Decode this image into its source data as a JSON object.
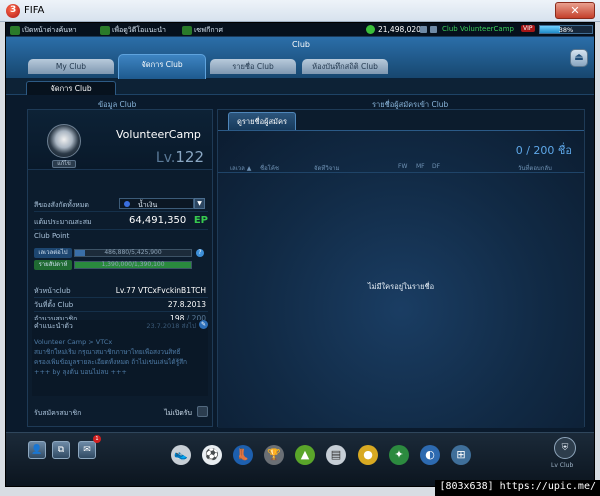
{
  "window": {
    "title": "FIFA",
    "app_icon_letter": "3",
    "close_glyph": "✕"
  },
  "topbar": {
    "nav": [
      "เปิดหน้าต่างค้นหา",
      "เพื่อดูวิดีโอแนะนำ",
      "เซฟกีกาศ"
    ],
    "coins": "21,498,020",
    "ticker": "Club VolunteerCamp",
    "vip": "VIP",
    "exp_percent": 38,
    "exp_label": "38%"
  },
  "header": {
    "title": "Club",
    "tabs": [
      {
        "label": "My Club",
        "active": false
      },
      {
        "label": "จัดการ Club",
        "active": true
      },
      {
        "label": "รายชื่อ Club",
        "active": false
      },
      {
        "label": "ห้องบันทึกสถิติ Club",
        "active": false
      }
    ],
    "home_glyph": "⏏",
    "subtab": "จัดการ Club"
  },
  "sections": {
    "left": "ข้อมูล Club",
    "right": "รายชื่อผู้สมัครเข้า Club"
  },
  "club": {
    "crest_button": "แก้ไข",
    "name": "VolunteerCamp",
    "lv_prefix": "Lv.",
    "level": "122",
    "color_label": "สีของสังกัดทั้งหมด",
    "color_value": "น้ำเงิน",
    "points_label": "แต้มประมาณสะสม",
    "points": "64,491,350",
    "points_unit": "EP",
    "club_point_label": "Club Point",
    "bars": [
      {
        "label": "เลเวลต่อไป",
        "value": "486,880/5,425,900",
        "fraction": 0.09,
        "color": "#3a6fa8",
        "label_bg": "#1d4670"
      },
      {
        "label": "รายสัปดาห์",
        "value": "1,390,000/1,390,100",
        "fraction": 1.0,
        "color": "#2a8a3e",
        "label_bg": "#1f6a32"
      }
    ],
    "info_rows": [
      {
        "label": "หัวหน้าclub",
        "value": "Lv.77 VTCxFvckinB1TCH"
      },
      {
        "label": "วันที่ตั้ง Club",
        "value": "27.8.2013"
      },
      {
        "label": "จำนวนสมาชิก",
        "value": "198",
        "max": " / 200"
      }
    ],
    "notice": {
      "label": "คำแนะนำตัว",
      "date": "23.7.2018 ส่งไป",
      "lines": [
        "Volunteer Camp > VTCx",
        "สมาชิกใหม่เริ่ม กรุณาสมาชิกภาษาไทยเพื่อสงวนสิทธิ์",
        "ครองเพิ่มข้อมูลรายละเอียดทั้งหมด ถ้าไม่เข่นเล่นได้รู้สึก",
        "+++ by ลุงต้น บอนไม่ลบ +++"
      ]
    },
    "recruit_label": "รับสมัครสมาชิก",
    "recruit_value": "ไม่เปิดรับ"
  },
  "applicants": {
    "tab": "ดูรายชื่อผู้สมัคร",
    "count": "0 / 200",
    "count_unit": "ชื่อ",
    "columns": [
      "เลเวล ▲",
      "ชื่อโค้ช",
      "จัดทีวิจาม",
      "FW",
      "MF",
      "DF",
      "วันที่ตอบกลับ"
    ],
    "empty_message": "ไม่มีใครอยู่ในรายชื่อ"
  },
  "bottom": {
    "left_buttons": [
      "👤",
      "⧉",
      "✉"
    ],
    "notification_count": "1",
    "tools": [
      "sneaker",
      "ball",
      "boot",
      "trophy",
      "cone",
      "card",
      "coin",
      "badge",
      "globe",
      "basket"
    ],
    "lv_club_label": "Lv Club"
  },
  "watermark": "[803x638] https://upic.me/"
}
